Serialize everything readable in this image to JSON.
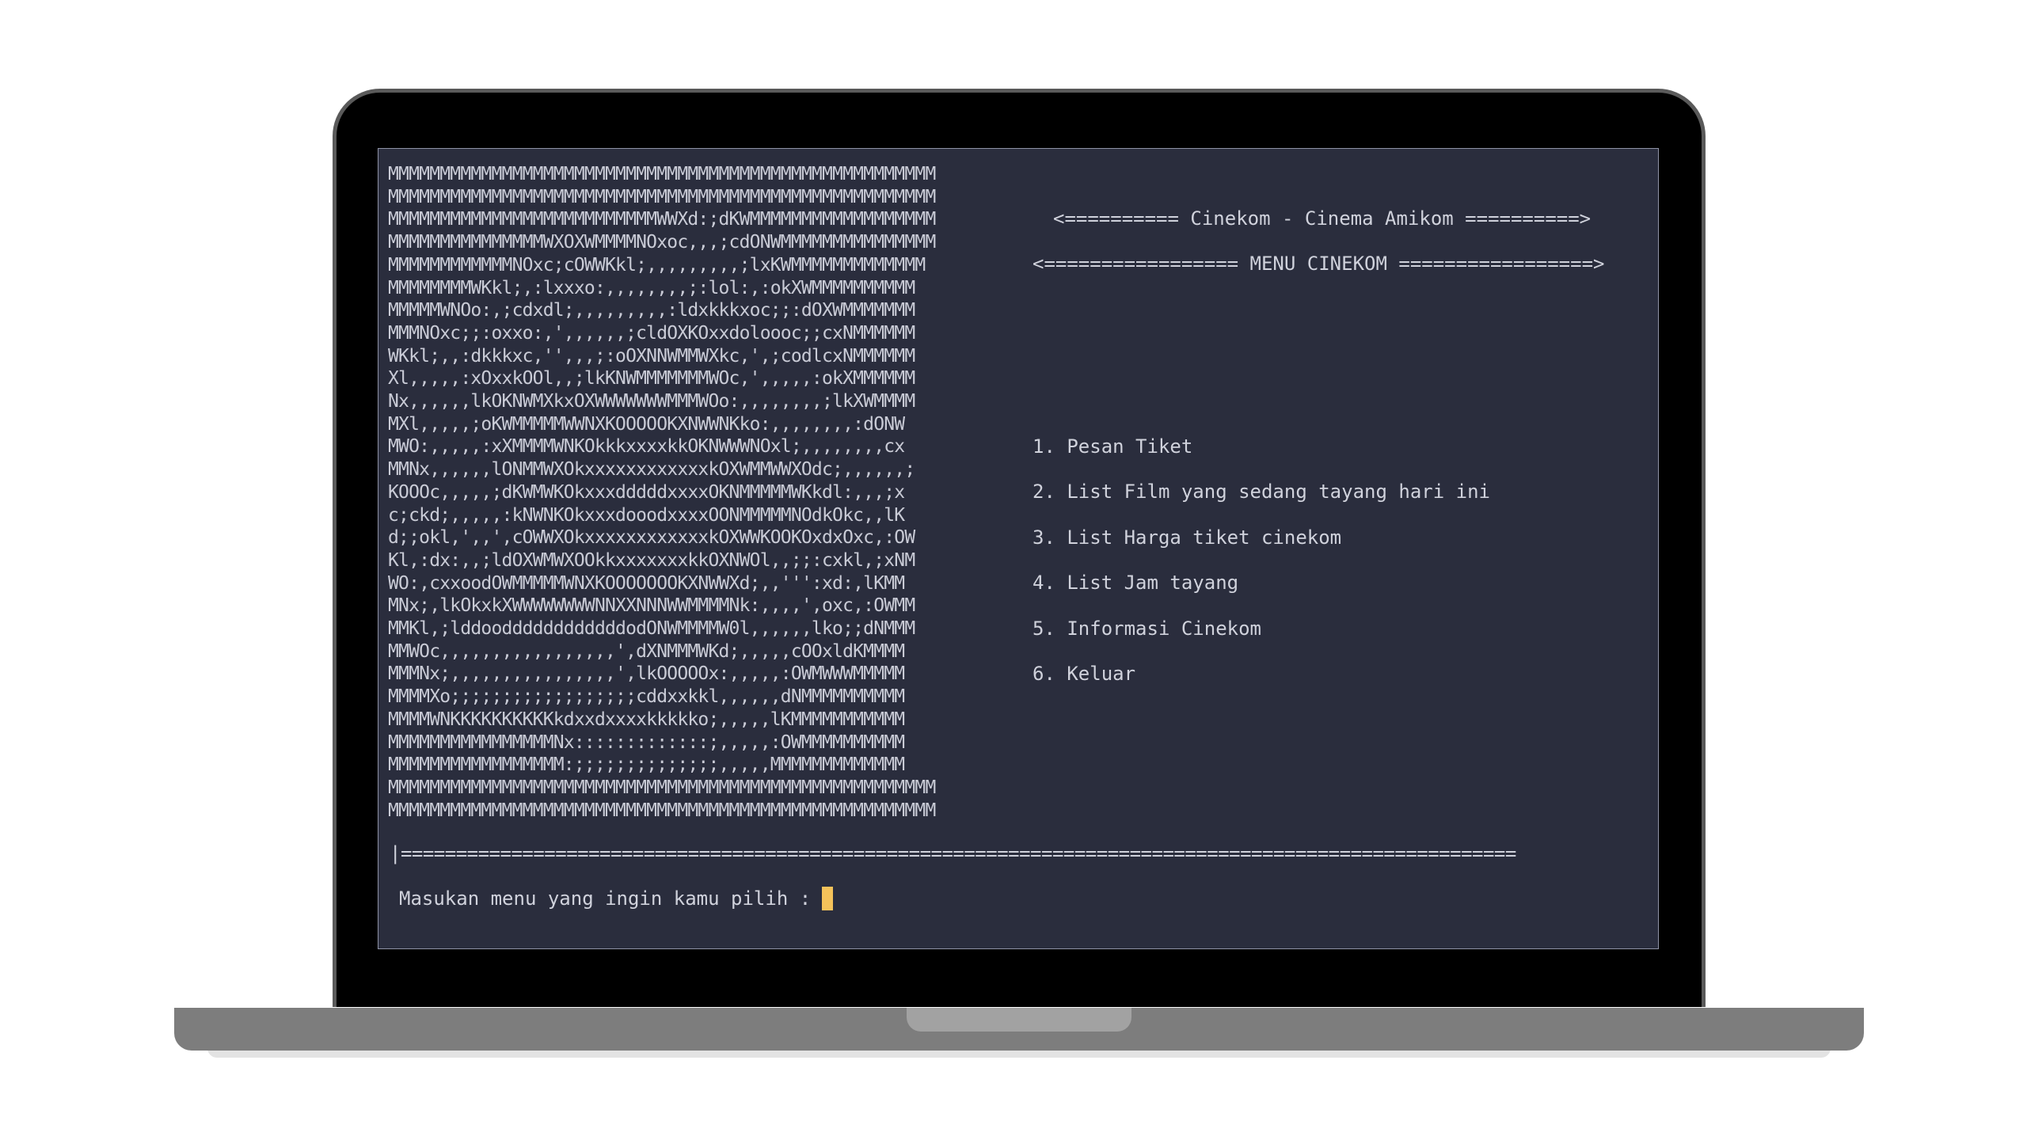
{
  "terminal": {
    "ascii_art": [
      "MMMMMMMMMMMMMMMMMMMMMMMMMMMMMMMMMMMMMMMMMMMMMMMMMMMMM",
      "MMMMMMMMMMMMMMMMMMMMMMMMMMMMMMMMMMMMMMMMMMMMMMMMMMMMM",
      "MMMMMMMMMMMMMMMMMMMMMMMMMMWWXd:;dKWMMMMMMMMMMMMMMMMMM",
      "MMMMMMMMMMMMMMMWXOXWMMMMNOxoc,,,;cdONWMMMMMMMMMMMMMMM",
      "MMMMMMMMMMMMNOxc;cOWWKkl;,,,,,,,,,;lxKWMMMMMMMMMMMMM",
      "MMMMMMMMWKkl;,:lxxxo:,,,,,,,,;:lol:,:okXWMMMMMMMMMM",
      "MMMMMWNOo:,;cdxdl;,,,,,,,,,:ldxkkkxoc;;:dOXWMMMMMMM",
      "MMMNOxc;;:oxxo:,',,,,,,;cldOXKOxxdoloooc;;cxNMMMMMM",
      "WKkl;,,:dkkkxc,'',,,;:oOXNNWMMWXkc,',;codlcxNMMMMMM",
      "Xl,,,,,:xOxxkOOl,,;lkKNWMMMMMMMWOc,',,,,,:okXMMMMMM",
      "Nx,,,,,,lkOKNWMXkxOXWWWWWWWMMMWOo:,,,,,,,,;lkXWMMMM",
      "MXl,,,,,;oKWMMMMMWWNXKOOOOOKXNWWNKko:,,,,,,,,:dONW",
      "MWO:,,,,,:xXMMMMWNKOkkkxxxxkkOKNWWWNOxl;,,,,,,,,cx",
      "MMNx,,,,,,lONMMWXOkxxxxxxxxxxxxkOXWMMWWXOdc;,,,,,,;",
      "KOOOc,,,,,;dKWMWKOkxxxdddddxxxxOKNMMMMMWKkdl:,,,;x",
      "c;ckd;,,,,,:kNWNKOkxxxdooodxxxxOONMMMMMNOdkOkc,,lK",
      "d;;okl,',,',cOWWXOkxxxxxxxxxxxxkOXWWKOOKOxdxOxc,:OW",
      "Kl,:dx:,,;ldOXWMWXOOkkxxxxxxxkkOXNWOl,,;;:cxkl,;xNM",
      "WO:,cxxoodOWMMMMMWNXKOOOOOOOKXNWWXd;,,''':xd:,lKMM",
      "MNx;,lkOkxkXWWWWWWWWNNXXNNNWWMMMMNk:,,,,',oxc,:OWMM",
      "MMKl,;lddooddddddddddddodONWMMMMW0l,,,,,,lko;;dNMMM",
      "MMWOc,,,,,,,,,,,,,,,,,',dXNMMMWKd;,,,,,cOOxldKMMMM",
      "MMMNx;,,,,,,,,,,,,,,,,',lkOOOOOx:,,,,,:OWMWWWMMMMM",
      "MMMMXo;;;;;;;;;;;;;;;;;;cddxxkkl,,,,,,dNMMMMMMMMMM",
      "MMMMWNKKKKKKKKKKkdxxdxxxxkkkkko;,,,,,lKMMMMMMMMMMM",
      "MMMMMMMMMMMMMMMMNx:::::::::::::;,,,,,:OWMMMMMMMMMM",
      "MMMMMMMMMMMMMMMMM:;;;;;;;;;;;;;;,,,,,MMMMMMMMMMMMM",
      "MMMMMMMMMMMMMMMMMMMMMMMMMMMMMMMMMMMMMMMMMMMMMMMMMMMMM",
      "MMMMMMMMMMMMMMMMMMMMMMMMMMMMMMMMMMMMMMMMMMMMMMMMMMMMM"
    ],
    "title": "<========== Cinekom - Cinema Amikom ==========>",
    "subtitle": "<================= MENU CINEKOM =================>",
    "menu": [
      "1. Pesan Tiket",
      "2. List Film yang sedang tayang hari ini",
      "3. List Harga tiket cinekom",
      "4. List Jam tayang",
      "5. Informasi Cinekom",
      "6. Keluar"
    ],
    "divider": "|=====================================================================================================",
    "prompt": "Masukan menu yang ingin kamu pilih :"
  }
}
